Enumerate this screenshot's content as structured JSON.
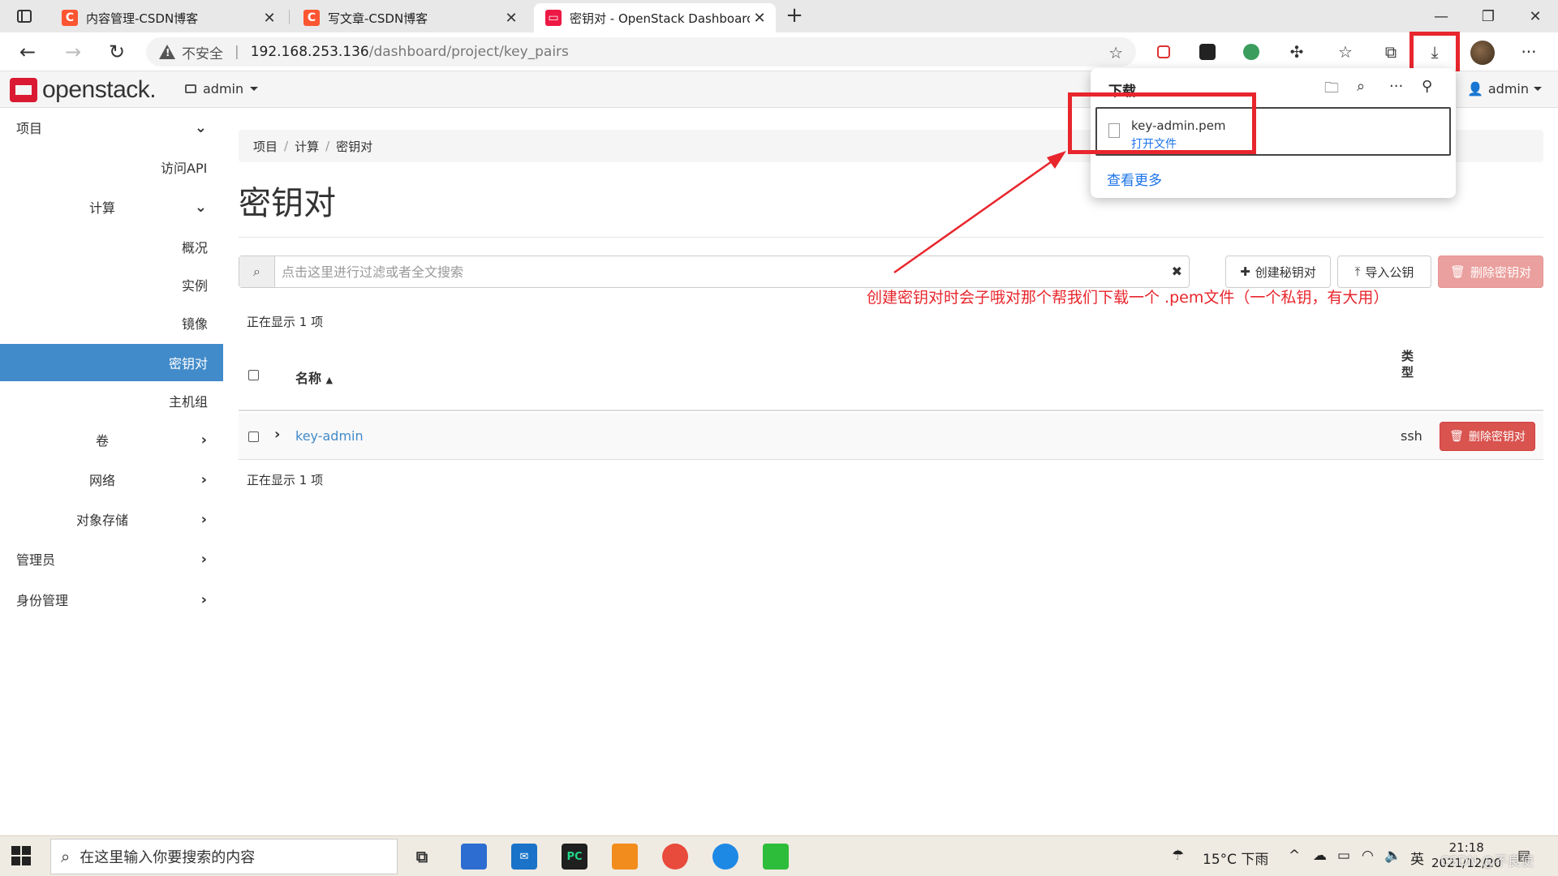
{
  "browser": {
    "tabs": [
      {
        "title": "内容管理-CSDN博客",
        "favicon": "csdn-icon"
      },
      {
        "title": "写文章-CSDN博客",
        "favicon": "csdn-icon"
      },
      {
        "title": "密钥对 - OpenStack Dashboard",
        "favicon": "openstack-icon"
      }
    ],
    "close_glyph": "✕",
    "new_tab_glyph": "+",
    "window_controls": {
      "minimize": "—",
      "maximize": "❐",
      "close": "✕"
    },
    "address": {
      "insecure_label": "不安全",
      "separator": "|",
      "host": "192.168.253.136",
      "path": "/dashboard/project/key_pairs"
    },
    "more_glyph": "···"
  },
  "download_popup": {
    "title": "下载",
    "file_name": "key-admin.pem",
    "open_file": "打开文件",
    "see_more": "查看更多",
    "tool_more": "···"
  },
  "header": {
    "logo_text": "openstack.",
    "project": "admin",
    "user": "admin"
  },
  "sidebar": {
    "items": [
      {
        "label": "项目",
        "chevron": "⌄"
      },
      {
        "label": "访问API",
        "chevron": ""
      },
      {
        "label": "计算",
        "chevron": "⌄"
      },
      {
        "label": "概况",
        "chevron": ""
      },
      {
        "label": "实例",
        "chevron": ""
      },
      {
        "label": "镜像",
        "chevron": ""
      },
      {
        "label": "密钥对",
        "chevron": ""
      },
      {
        "label": "主机组",
        "chevron": ""
      },
      {
        "label": "卷",
        "chevron": "›"
      },
      {
        "label": "网络",
        "chevron": "›"
      },
      {
        "label": "对象存储",
        "chevron": "›"
      },
      {
        "label": "管理员",
        "chevron": "›"
      },
      {
        "label": "身份管理",
        "chevron": "›"
      }
    ]
  },
  "main": {
    "breadcrumb": [
      "项目",
      "计算",
      "密钥对"
    ],
    "breadcrumb_sep": "/",
    "title": "密钥对",
    "search_placeholder": "点击这里进行过滤或者全文搜索",
    "clear_glyph": "✖",
    "buttons": {
      "create": "创建秘钥对",
      "import": "导入公钥",
      "delete": "删除密钥对"
    },
    "count_top": "正在显示 1 项",
    "count_bottom": "正在显示 1 项",
    "table": {
      "columns": {
        "name": "名称",
        "type": "类型"
      },
      "sort_glyph": "▲",
      "rows": [
        {
          "name": "key-admin",
          "type": "ssh",
          "action": "删除密钥对"
        }
      ]
    }
  },
  "annotation": "创建密钥对时会子哦对那个帮我们下载一个   .pem文件（一个私钥，有大用）",
  "taskbar": {
    "search_placeholder": "在这里输入你要搜索的内容",
    "weather": "15°C  下雨",
    "ime": "英",
    "time": "21:18",
    "date": "2021/12/20",
    "watermark": "CSDN @不良使"
  },
  "colors": {
    "accent": "#428bca",
    "danger": "#d9534f",
    "annotation_red": "#e8262d",
    "openstack_red": "#da1a32"
  }
}
